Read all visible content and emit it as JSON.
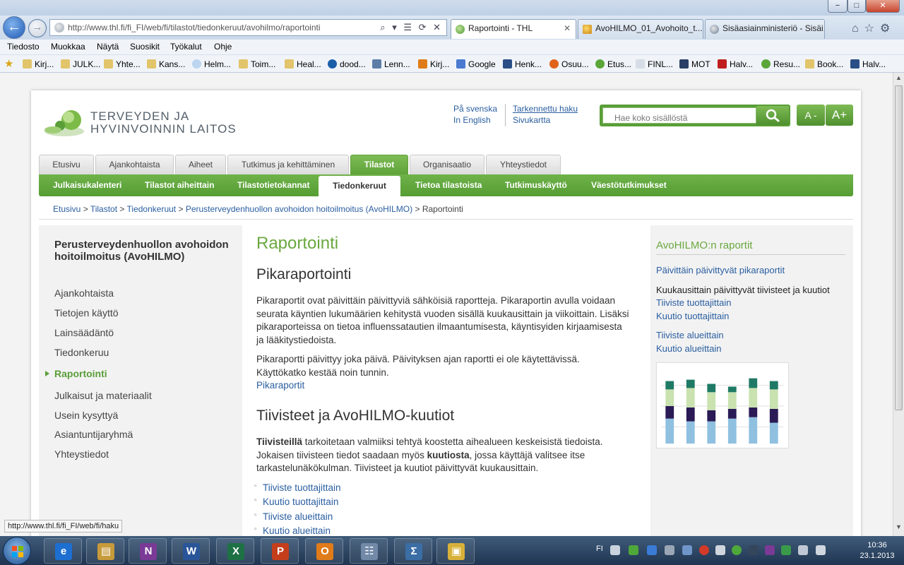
{
  "browser": {
    "address_url": "http://www.thl.fi/fi_FI/web/fi/tilastot/tiedonkeruut/avohilmo/raportointi",
    "tabs": [
      "Raportointi - THL",
      "AvoHILMO_01_Avohoito_t...",
      "Sisäasiainministeriö - Sisäi..."
    ],
    "menu": [
      "Tiedosto",
      "Muokkaa",
      "Näytä",
      "Suosikit",
      "Työkalut",
      "Ohje"
    ],
    "favorites": [
      "Kirj...",
      "JULK...",
      "Yhte...",
      "Kans...",
      "Helm...",
      "Toim...",
      "Heal...",
      "dood...",
      "Lenn...",
      "Kirj...",
      "Google",
      "Henk...",
      "Osuu...",
      "Etus...",
      "FINL...",
      "MOT",
      "Halv...",
      "Resu...",
      "Book...",
      "Halv..."
    ],
    "status_url": "http://www.thl.fi/fi_FI/web/fi/haku",
    "glyphs": {
      "back": "←",
      "forward": "→",
      "min": "−",
      "max": "□",
      "close": "✕",
      "tab_close": "✕",
      "address_tools": "⌕ ▾ ☰ ⟳ ✕",
      "nav_icons": "⌂☆⚙",
      "favorites_star": "★",
      "scroll_up": "▲",
      "scroll_down": "▼"
    }
  },
  "site": {
    "logo_line1": "TERVEYDEN JA",
    "logo_line2": "HYVINVOINNIN LAITOS",
    "lang_sv": "På svenska",
    "lang_en": "In English",
    "adv_search": "Tarkennettu haku",
    "sitemap": "Sivukartta",
    "search_placeholder": "Hae koko sisällöstä",
    "font_smaller": "A -",
    "font_larger": "A+",
    "top_tabs": [
      "Etusivu",
      "Ajankohtaista",
      "Aiheet",
      "Tutkimus ja kehittäminen",
      "Tilastot",
      "Organisaatio",
      "Yhteystiedot"
    ],
    "sub_tabs": [
      "Julkaisukalenteri",
      "Tilastot aiheittain",
      "Tilastotietokannat",
      "Tiedonkeruut",
      "Tietoa tilastoista",
      "Tutkimuskäyttö",
      "Väestötutkimukset"
    ],
    "breadcrumb": {
      "links": [
        "Etusivu",
        "Tilastot",
        "Tiedonkeruut",
        "Perusterveydenhuollon avohoidon hoitoilmoitus (AvoHILMO)"
      ],
      "separator": " > ",
      "current": "Raportointi"
    }
  },
  "leftnav": {
    "title": "Perusterveydenhuollon avohoidon hoitoilmoitus (AvoHILMO)",
    "items": [
      "Ajankohtaista",
      "Tietojen käyttö",
      "Lainsäädäntö",
      "Tiedonkeruu",
      "Raportointi",
      "Julkaisut ja materiaalit",
      "Usein kysyttyä",
      "Asiantuntijaryhmä",
      "Yhteystiedot"
    ]
  },
  "main": {
    "title": "Raportointi",
    "h2_1": "Pikaraportointi",
    "p1": "Pikaraportit ovat päivittäin päivittyviä sähköisiä raportteja. Pikaraportin avulla voidaan seurata käyntien lukumäärien kehitystä vuoden sisällä kuukausittain ja viikoittain. Lisäksi pikaraporteissa on tietoa influenssatautien ilmaantumisesta, käyntisyiden kirjaamisesta ja lääkitystiedoista.",
    "p2": "Pikaraportti päivittyy joka päivä. Päivityksen ajan raportti ei ole käytettävissä. Käyttökatko kestää noin tunnin.",
    "p2_link": "Pikaraportit",
    "h2_2": "Tiivisteet ja AvoHILMO-kuutiot",
    "p3_bold1": "Tiivisteillä",
    "p3_a": " tarkoitetaan valmiiksi tehtyä koostetta aihealueen keskeisistä tiedoista. Jokaisen tiivisteen tiedot saadaan myös ",
    "p3_bold2": "kuutiosta",
    "p3_b": ", jossa käyttäjä valitsee itse tarkastelunäkökulman. Tiivisteet ja kuutiot päivittyvät kuukausittain.",
    "bullets": [
      "Tiiviste tuottajittain",
      "Kuutio tuottajittain",
      "Tiiviste alueittain",
      "Kuutio alueittain"
    ]
  },
  "sidebar": {
    "title": "AvoHILMO:n raportit",
    "link_daily": "Päivittäin päivittyvät pikaraportit",
    "monthly_text": "Kuukausittain päivittyvät tiivisteet ja kuutiot",
    "links": [
      "Tiiviste tuottajittain",
      "Kuutio tuottajittain",
      "Tiiviste alueittain",
      "Kuutio alueittain"
    ]
  },
  "taskbar": {
    "lang": "FI",
    "time": "10:36",
    "date": "23.1.2013",
    "apps": [
      {
        "glyph": "e",
        "color": "#1d6fd1"
      },
      {
        "glyph": "▤",
        "color": "#c79a3a"
      },
      {
        "glyph": "N",
        "color": "#7a3a96"
      },
      {
        "glyph": "W",
        "color": "#2a5699"
      },
      {
        "glyph": "X",
        "color": "#1e7145"
      },
      {
        "glyph": "P",
        "color": "#c43e1c"
      },
      {
        "glyph": "O",
        "color": "#e07b1a"
      },
      {
        "glyph": "☷",
        "color": "#7289a8"
      },
      {
        "glyph": "Σ",
        "color": "#3b6ea5"
      },
      {
        "glyph": "▣",
        "color": "#d8b13a"
      }
    ]
  },
  "colors": {
    "brand_green": "#5a9e38",
    "link_blue": "#2a5ea0",
    "title_green": "#6aa83f"
  }
}
